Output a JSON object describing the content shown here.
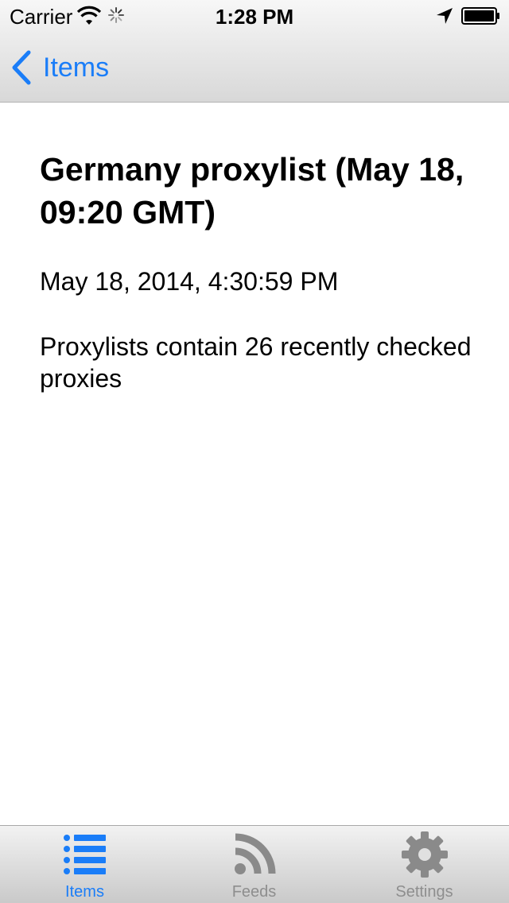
{
  "status_bar": {
    "carrier": "Carrier",
    "time": "1:28 PM",
    "icons": [
      "wifi-icon",
      "activity-spinner-icon",
      "location-arrow-icon",
      "battery-icon"
    ]
  },
  "nav": {
    "back_label": "Items",
    "back_icon": "chevron-left-icon"
  },
  "item": {
    "title": "Germany proxylist (May 18, 09:20 GMT)",
    "date": "May 18, 2014, 4:30:59 PM",
    "body": "Proxylists contain 26 recently checked proxies"
  },
  "tab_bar": {
    "tabs": [
      {
        "label": "Items",
        "icon": "list-icon",
        "active": true
      },
      {
        "label": "Feeds",
        "icon": "rss-icon",
        "active": false
      },
      {
        "label": "Settings",
        "icon": "gear-icon",
        "active": false
      }
    ]
  },
  "colors": {
    "accent": "#1a7df8",
    "inactive_tab": "#8e8e8e"
  }
}
